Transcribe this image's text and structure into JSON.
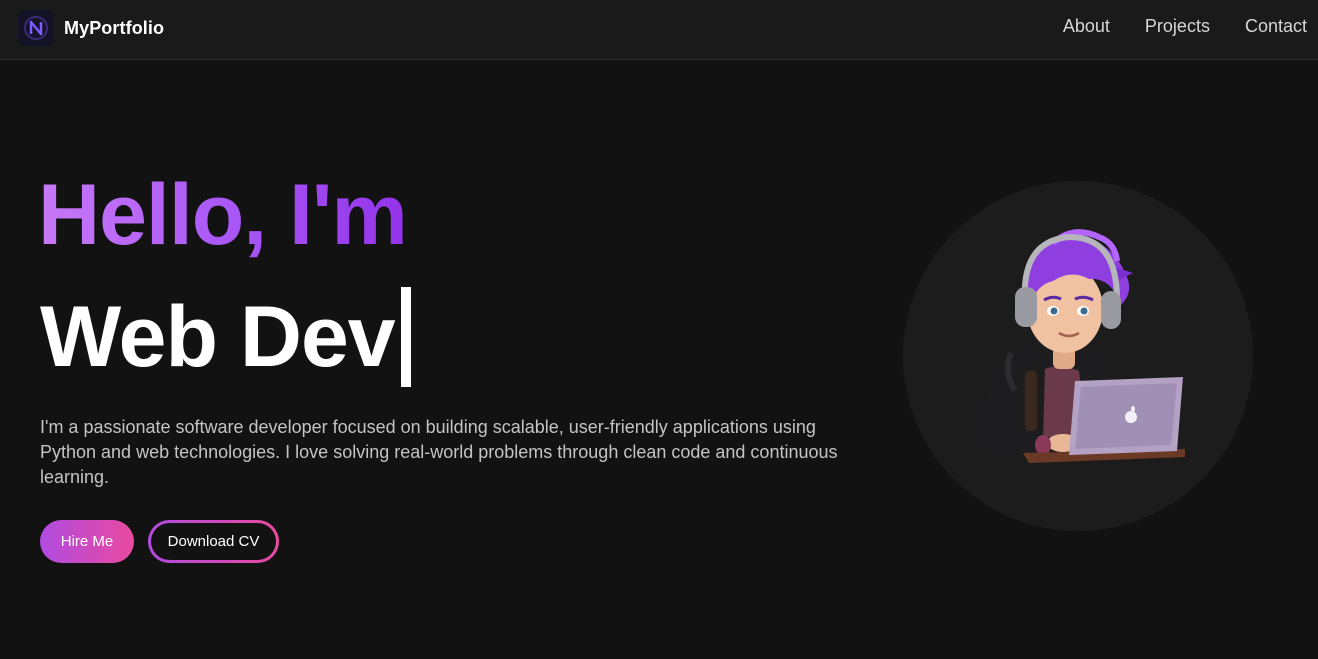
{
  "navbar": {
    "brand": "MyPortfolio",
    "logo_icon": "n-logo-icon",
    "links": [
      "About",
      "Projects",
      "Contact"
    ]
  },
  "hero": {
    "greeting": "Hello, I'm",
    "role": "Web Dev",
    "description": "I'm a passionate software developer focused on building scalable, user-friendly applications using Python and web technologies. I love solving real-world problems through clean code and continuous learning.",
    "primary_button": "Hire Me",
    "secondary_button": "Download CV"
  },
  "illustration": {
    "icon": "developer-avatar-illustration"
  },
  "colors": {
    "background": "#121212",
    "navbar": "#1a1a1a",
    "accent_purple": "#a855f7",
    "accent_pink": "#e94aa0"
  }
}
